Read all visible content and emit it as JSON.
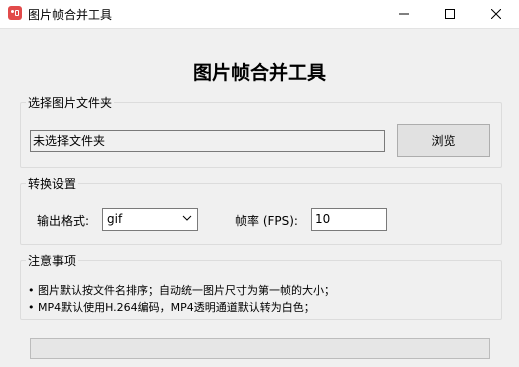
{
  "window": {
    "title": "图片帧合并工具",
    "controls": {
      "minimize_icon": "minimize-icon",
      "maximize_icon": "maximize-icon",
      "close_icon": "close-icon"
    }
  },
  "heading": "图片帧合并工具",
  "folder_group": {
    "title": "选择图片文件夹",
    "path_value": "未选择文件夹",
    "browse_label": "浏览"
  },
  "settings_group": {
    "title": "转换设置",
    "format_label": "输出格式:",
    "format_value": "gif",
    "fps_label": "帧率 (FPS):",
    "fps_value": "10"
  },
  "notes_group": {
    "title": "注意事项",
    "items": [
      "• 图片默认按文件名排序；自动统一图片尺寸为第一帧的大小；",
      "• MP4默认使用H.264编码，MP4透明通道默认转为白色；"
    ]
  },
  "progress": {
    "value": 0
  },
  "colors": {
    "app_icon": "#e24b4b",
    "window_bg": "#f0f0f0",
    "button_bg": "#e1e1e1"
  }
}
